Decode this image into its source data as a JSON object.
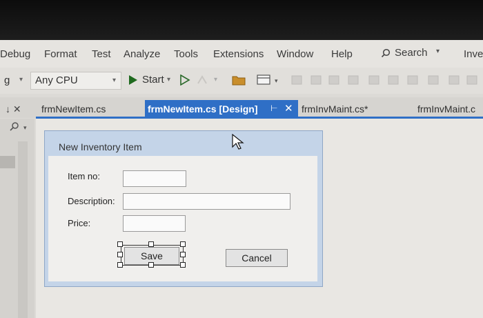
{
  "menu": {
    "items": [
      "Debug",
      "Format",
      "Test",
      "Analyze",
      "Tools",
      "Extensions",
      "Window",
      "Help"
    ],
    "search_label": "Search",
    "overflow_label": "Inve"
  },
  "toolbar": {
    "config_value": "g",
    "platform_value": "Any CPU",
    "start_label": "Start"
  },
  "tabs": {
    "pin_close": "↓ ✕",
    "items": [
      "frmNewItem.cs",
      "frmNewItem.cs [Design]",
      "frmInvMaint.cs*",
      "frmInvMaint.c"
    ]
  },
  "form": {
    "title": "New Inventory Item",
    "item_no_label": "Item no:",
    "description_label": "Description:",
    "price_label": "Price:",
    "save_label": "Save",
    "cancel_label": "Cancel"
  }
}
